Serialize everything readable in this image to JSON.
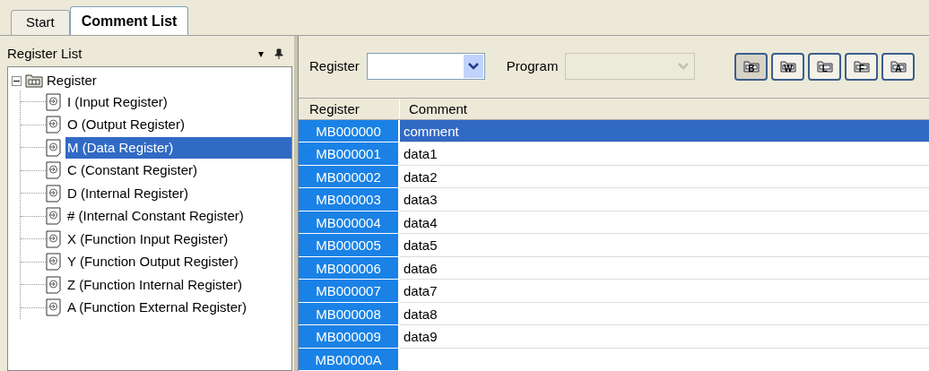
{
  "tabs": [
    {
      "label": "Start",
      "selected": false
    },
    {
      "label": "Comment List",
      "selected": true
    }
  ],
  "register_list": {
    "title": "Register List",
    "pin_menu": "▾",
    "root": {
      "label": "Register",
      "expanded": true,
      "children": [
        {
          "label": "I (Input Register)",
          "selected": false
        },
        {
          "label": "O (Output Register)",
          "selected": false
        },
        {
          "label": "M (Data Register)",
          "selected": true
        },
        {
          "label": "C (Constant Register)",
          "selected": false
        },
        {
          "label": "D (Internal Register)",
          "selected": false
        },
        {
          "label": "# (Internal Constant Register)",
          "selected": false
        },
        {
          "label": "X (Function Input Register)",
          "selected": false
        },
        {
          "label": "Y (Function Output Register)",
          "selected": false
        },
        {
          "label": "Z (Function Internal Register)",
          "selected": false
        },
        {
          "label": "A (Function External Register)",
          "selected": false
        }
      ]
    }
  },
  "toolbar": {
    "register_label": "Register",
    "program_label": "Program",
    "program_disabled": true,
    "type_buttons": [
      {
        "label": "B",
        "selected": true
      },
      {
        "label": "W",
        "selected": false
      },
      {
        "label": "L",
        "selected": false
      },
      {
        "label": "F",
        "selected": false
      },
      {
        "label": "A",
        "selected": false
      }
    ]
  },
  "table": {
    "columns": [
      "Register",
      "Comment"
    ],
    "rows": [
      {
        "register": "MB000000",
        "comment": "comment",
        "selected": true
      },
      {
        "register": "MB000001",
        "comment": "data1",
        "selected": false
      },
      {
        "register": "MB000002",
        "comment": "data2",
        "selected": false
      },
      {
        "register": "MB000003",
        "comment": "data3",
        "selected": false
      },
      {
        "register": "MB000004",
        "comment": "data4",
        "selected": false
      },
      {
        "register": "MB000005",
        "comment": "data5",
        "selected": false
      },
      {
        "register": "MB000006",
        "comment": "data6",
        "selected": false
      },
      {
        "register": "MB000007",
        "comment": "data7",
        "selected": false
      },
      {
        "register": "MB000008",
        "comment": "data8",
        "selected": false
      },
      {
        "register": "MB000009",
        "comment": "data9",
        "selected": false
      },
      {
        "register": "MB00000A",
        "comment": "",
        "selected": false
      }
    ]
  }
}
